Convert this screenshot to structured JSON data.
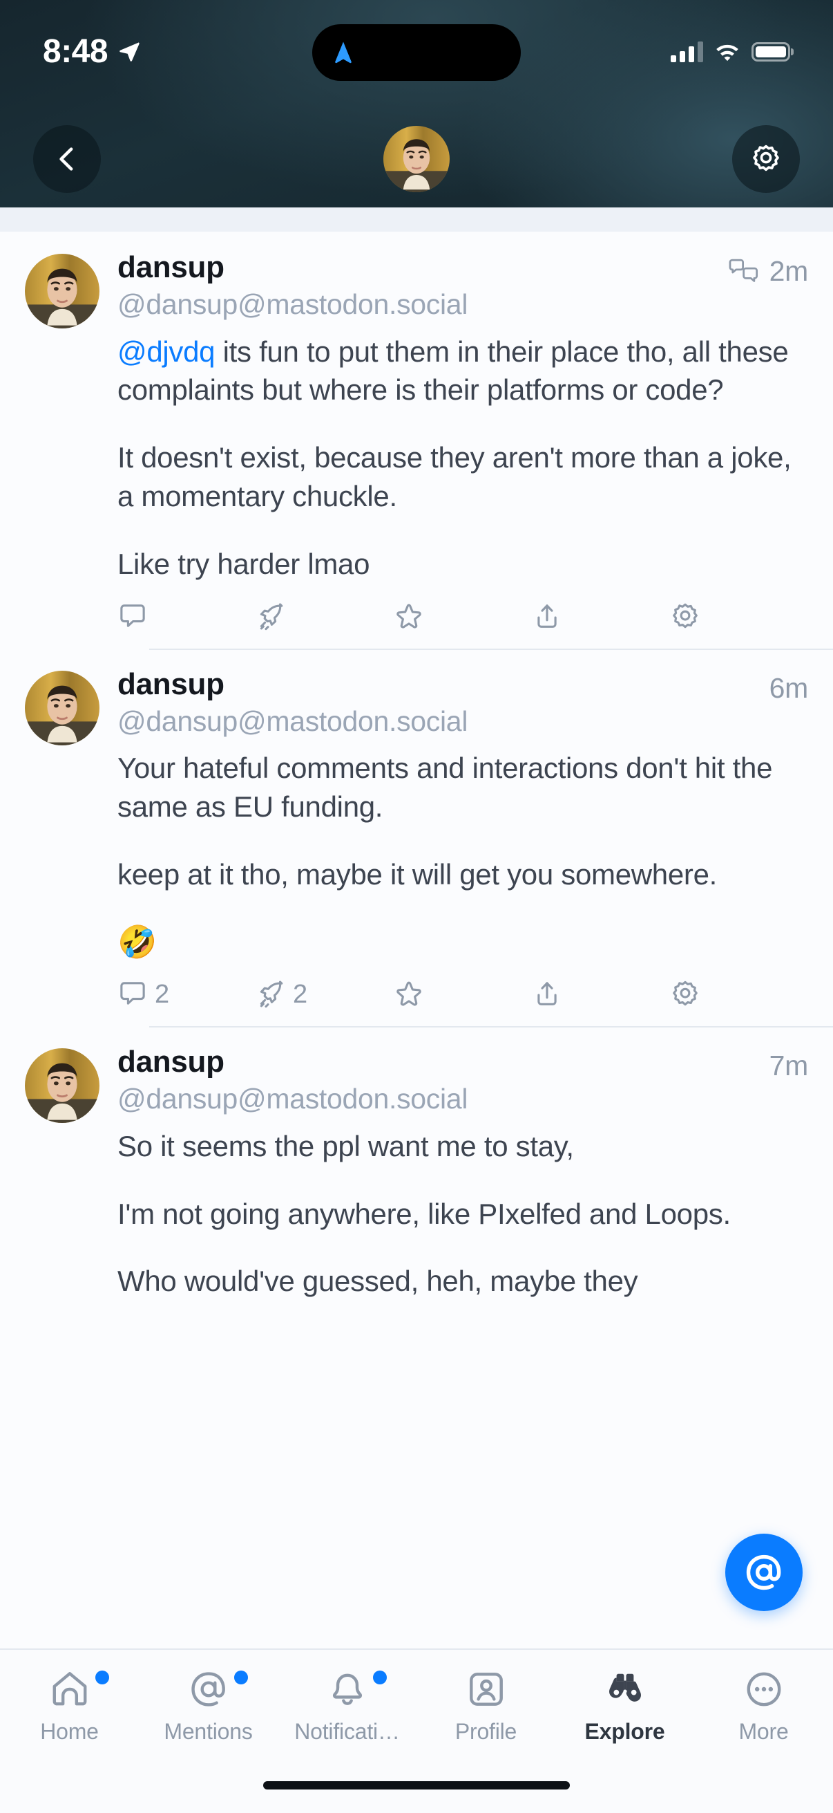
{
  "status_bar": {
    "time": "8:48",
    "location_icon": "location-arrow-icon",
    "dynamic_island_icon": "navigation-arrow-icon",
    "cellular_icon": "cellular-signal-icon",
    "wifi_icon": "wifi-icon",
    "battery_icon": "battery-full-icon"
  },
  "header": {
    "back_icon": "chevron-left-icon",
    "avatar_name": "profile-avatar",
    "settings_icon": "gear-icon"
  },
  "colors": {
    "accent": "#0a7cff",
    "mention": "#0a7cff",
    "body_text": "#3d4450",
    "muted_text": "#8e99a8",
    "handle_text": "#9aa5b5",
    "header_bg": "#1b3039",
    "feed_bg": "#fbfcfe",
    "badge_dot": "#0a7cff"
  },
  "posts": [
    {
      "display_name": "dansup",
      "handle": "@dansup@mastodon.social",
      "timestamp": "2m",
      "has_thread_icon": true,
      "thread_icon": "reply-chain-icon",
      "mention": "@djvdq",
      "paragraphs": [
        " its fun to put them in their place tho, all these complaints but where is their platforms or code?",
        "It doesn't exist, because they aren't more than a joke, a momentary chuckle.",
        "Like try harder lmao"
      ],
      "emoji": "",
      "actions": {
        "comment_count": "",
        "boost_count": "",
        "favourite_count": "",
        "share_count": "",
        "more_count": ""
      }
    },
    {
      "display_name": "dansup",
      "handle": "@dansup@mastodon.social",
      "timestamp": "6m",
      "has_thread_icon": false,
      "thread_icon": "",
      "mention": "",
      "paragraphs": [
        "Your hateful comments and interactions don't hit the same as EU funding.",
        "keep at it tho, maybe it will get you somewhere."
      ],
      "emoji": "🤣",
      "actions": {
        "comment_count": "2",
        "boost_count": "2",
        "favourite_count": "",
        "share_count": "",
        "more_count": ""
      }
    },
    {
      "display_name": "dansup",
      "handle": "@dansup@mastodon.social",
      "timestamp": "7m",
      "has_thread_icon": false,
      "thread_icon": "",
      "mention": "",
      "paragraphs": [
        "So it seems the ppl want me to stay,",
        "I'm not going anywhere, like PIxelfed and Loops.",
        "Who would've guessed, heh, maybe they"
      ],
      "emoji": "",
      "actions": {
        "comment_count": "",
        "boost_count": "",
        "favourite_count": "",
        "share_count": "",
        "more_count": ""
      }
    }
  ],
  "action_icons": {
    "comment": "comment-icon",
    "boost": "rocket-boost-icon",
    "favourite": "star-icon",
    "share": "share-icon",
    "more": "gear-icon"
  },
  "fab": {
    "icon": "at-sign-icon",
    "label": "@"
  },
  "tabbar": {
    "items": [
      {
        "label": "Home",
        "icon": "home-icon",
        "badge": true,
        "active": false
      },
      {
        "label": "Mentions",
        "icon": "at-sign-icon",
        "badge": true,
        "active": false
      },
      {
        "label": "Notificati…",
        "icon": "bell-icon",
        "badge": true,
        "active": false
      },
      {
        "label": "Profile",
        "icon": "user-card-icon",
        "badge": false,
        "active": false
      },
      {
        "label": "Explore",
        "icon": "binoculars-icon",
        "badge": false,
        "active": true
      },
      {
        "label": "More",
        "icon": "ellipsis-circle-icon",
        "badge": false,
        "active": false
      }
    ]
  }
}
